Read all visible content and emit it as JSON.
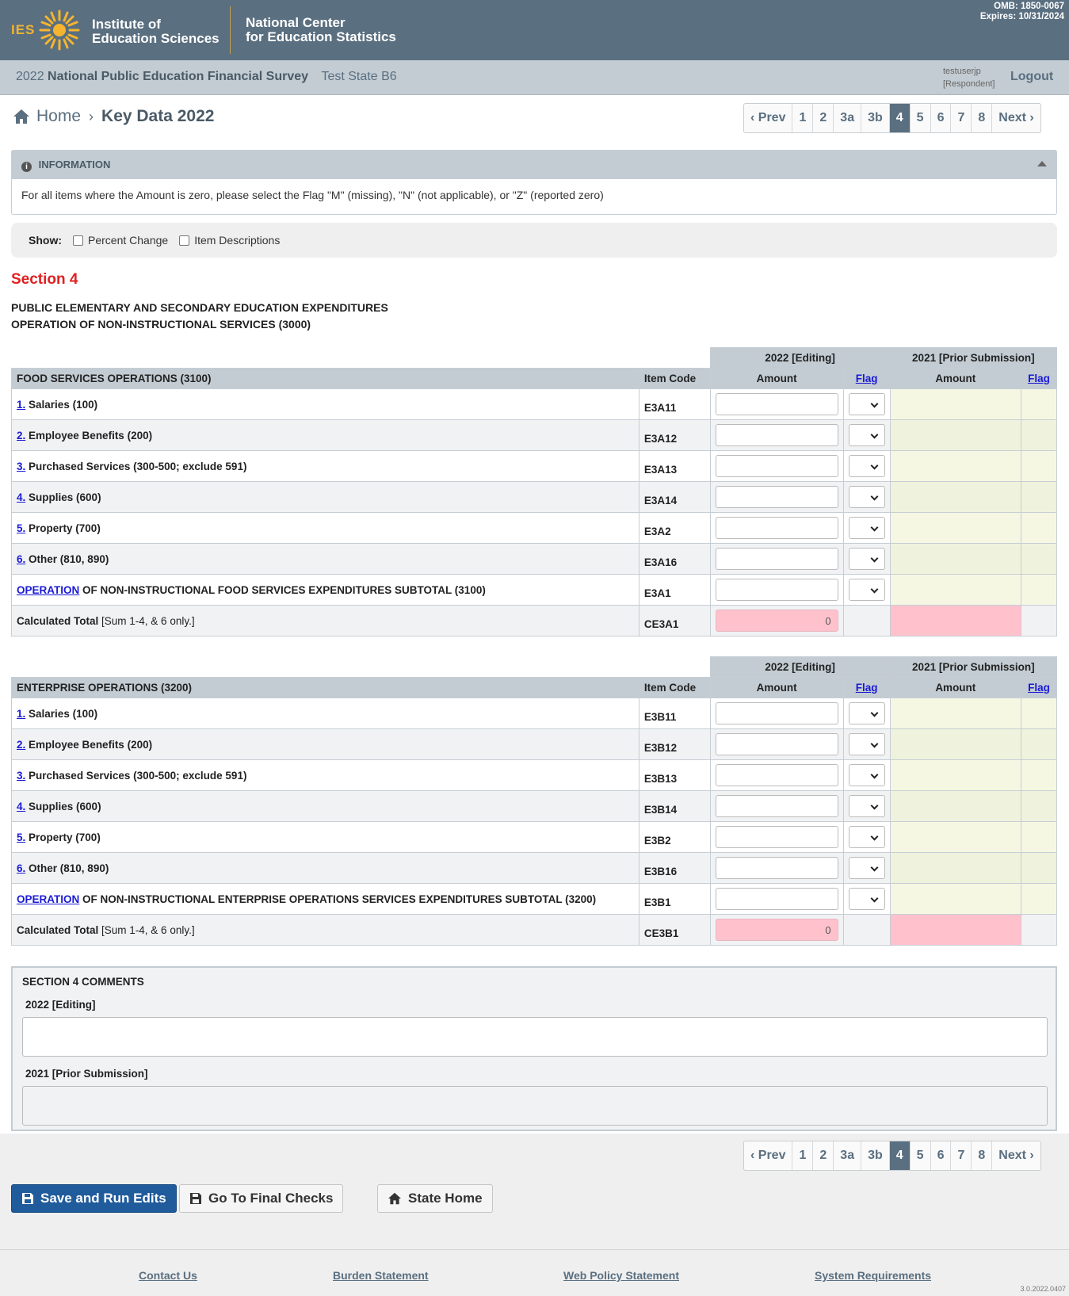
{
  "header": {
    "ies_abbr": "IES",
    "ies_name_1": "Institute of",
    "ies_name_2": "Education Sciences",
    "nces_name_1": "National Center",
    "nces_name_2": "for Education Statistics",
    "omb": "OMB: 1850-0067",
    "expires": "Expires: 10/31/2024",
    "colors": {
      "banner": "#5a6f80",
      "accent": "#f5b52e"
    }
  },
  "subbar": {
    "year": "2022",
    "survey": "National Public Education Financial Survey",
    "state": "Test State B6",
    "username": "testuserjp",
    "role": "[Respondent]",
    "logout": "Logout"
  },
  "breadcrumb": {
    "home": "Home",
    "current": "Key Data 2022"
  },
  "pager": {
    "prev": "Prev",
    "next": "Next",
    "pages": [
      "1",
      "2",
      "3a",
      "3b",
      "4",
      "5",
      "6",
      "7",
      "8"
    ],
    "active": "4"
  },
  "info": {
    "title": "INFORMATION",
    "text": "For all items where the Amount is zero, please select the Flag \"M\" (missing), \"N\" (not applicable), or \"Z\" (reported zero)"
  },
  "show": {
    "label": "Show:",
    "opt1": "Percent Change",
    "opt2": "Item Descriptions"
  },
  "section": {
    "title": "Section 4",
    "line1": "PUBLIC ELEMENTARY AND SECONDARY EDUCATION EXPENDITURES",
    "line2": "OPERATION OF NON-INSTRUCTIONAL SERVICES (3000)"
  },
  "columns": {
    "editing": "2022 [Editing]",
    "prior": "2021 [Prior Submission]",
    "item_code": "Item Code",
    "amount": "Amount",
    "flag": "Flag"
  },
  "food": {
    "title": "FOOD SERVICES OPERATIONS (3100)",
    "rows": [
      {
        "num": "1.",
        "label": "Salaries (100)",
        "code": "E3A11"
      },
      {
        "num": "2.",
        "label": "Employee Benefits (200)",
        "code": "E3A12"
      },
      {
        "num": "3.",
        "label": "Purchased Services (300-500; exclude 591)",
        "code": "E3A13"
      },
      {
        "num": "4.",
        "label": "Supplies (600)",
        "code": "E3A14"
      },
      {
        "num": "5.",
        "label": "Property (700)",
        "code": "E3A2"
      },
      {
        "num": "6.",
        "label": "Other (810, 890)",
        "code": "E3A16"
      }
    ],
    "subtotal_link": "OPERATION",
    "subtotal_label": " OF NON-INSTRUCTIONAL FOOD SERVICES EXPENDITURES SUBTOTAL (3100)",
    "subtotal_code": "E3A1",
    "calc_label": "Calculated Total",
    "calc_note": " [Sum 1-4, & 6 only.]",
    "calc_code": "CE3A1",
    "calc_value": "0"
  },
  "enterprise": {
    "title": "ENTERPRISE OPERATIONS (3200)",
    "rows": [
      {
        "num": "1.",
        "label": "Salaries (100)",
        "code": "E3B11"
      },
      {
        "num": "2.",
        "label": "Employee Benefits (200)",
        "code": "E3B12"
      },
      {
        "num": "3.",
        "label": "Purchased Services (300-500; exclude 591)",
        "code": "E3B13"
      },
      {
        "num": "4.",
        "label": "Supplies (600)",
        "code": "E3B14"
      },
      {
        "num": "5.",
        "label": "Property (700)",
        "code": "E3B2"
      },
      {
        "num": "6.",
        "label": "Other (810, 890)",
        "code": "E3B16"
      }
    ],
    "subtotal_link": "OPERATION",
    "subtotal_label": " OF NON-INSTRUCTIONAL ENTERPRISE OPERATIONS SERVICES EXPENDITURES SUBTOTAL (3200)",
    "subtotal_code": "E3B1",
    "calc_label": "Calculated Total",
    "calc_note": " [Sum 1-4, & 6 only.]",
    "calc_code": "CE3B1",
    "calc_value": "0"
  },
  "comments": {
    "title": "SECTION 4 COMMENTS",
    "editing_label": "2022 [Editing]",
    "prior_label": "2021 [Prior Submission]"
  },
  "buttons": {
    "save": "Save and Run Edits",
    "final": "Go To Final Checks",
    "state_home": "State Home"
  },
  "footer": {
    "contact": "Contact Us",
    "burden": "Burden Statement",
    "policy": "Web Policy Statement",
    "requirements": "System Requirements",
    "version": "3.0.2022.0407"
  }
}
